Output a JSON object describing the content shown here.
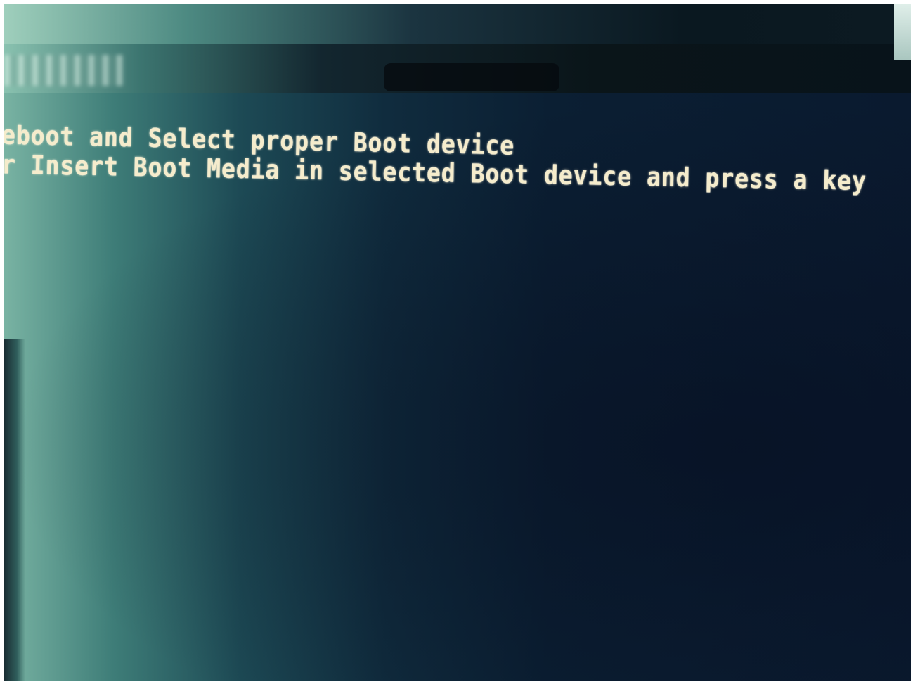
{
  "screen": {
    "lines": [
      "eboot and Select proper Boot device",
      "r Insert Boot Media in selected Boot device and press a key"
    ]
  },
  "colors": {
    "text": "#f5eccc",
    "screen_background": "#0a1a2f",
    "glare": "#79b3a3"
  }
}
